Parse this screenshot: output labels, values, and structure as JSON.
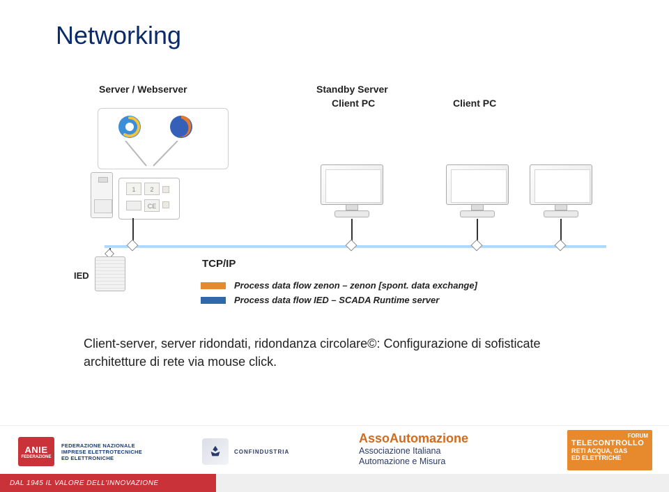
{
  "title": "Networking",
  "labels": {
    "server_webserver": "Server / Webserver",
    "standby_server": "Standby Server",
    "client_pc_1": "Client PC",
    "client_pc_2": "Client PC",
    "tcpip": "TCP/IP",
    "ied": "IED"
  },
  "legend": {
    "orange": "Process data flow zenon – zenon [spont. data exchange]",
    "blue": "Process data flow IED – SCADA Runtime server"
  },
  "body_text": "Client-server, server ridondati, ridondanza circolare©: Configurazione di sofisticate architetture di rete via mouse click.",
  "footer": {
    "anie_badge_top": "ANIE",
    "anie_badge_bottom": "FEDERAZIONE",
    "anie_text_l1": "FEDERAZIONE NAZIONALE",
    "anie_text_l2": "IMPRESE ELETTROTECNICHE",
    "anie_text_l3": "ED ELETTRONICHE",
    "confind": "CONFINDUSTRIA",
    "assoa_title": "AssoAutomazione",
    "assoa_line1": "Associazione Italiana",
    "assoa_line2": "Automazione e Misura",
    "tc_title": "TELECONTROLLO",
    "tc_line1": "RETI ACQUA, GAS",
    "tc_line2": "ED ELETTRICHE",
    "tc_forum": "FORUM",
    "strip": "DAL 1945 IL VALORE DELL'INNOVAZIONE"
  }
}
